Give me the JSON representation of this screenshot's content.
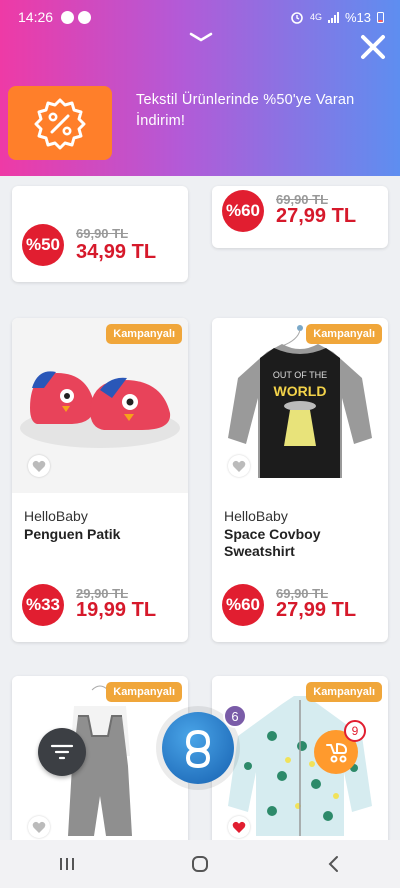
{
  "status_bar": {
    "time": "14:26",
    "network": "4G",
    "battery": "%13"
  },
  "banner": {
    "message": "Tekstil Ürünlerinde %50'ye Varan İndirim!",
    "icon": "percent-badge-icon"
  },
  "products": [
    {
      "discount": "%50",
      "old_price": "69,90 TL",
      "new_price": "34,99 TL"
    },
    {
      "discount": "%60",
      "old_price": "69,90 TL",
      "new_price": "27,99 TL"
    },
    {
      "badge": "Kampanyalı",
      "brand": "HelloBaby",
      "name": "Penguen Patik",
      "discount": "%33",
      "old_price": "29,90 TL",
      "new_price": "19,99 TL"
    },
    {
      "badge": "Kampanyalı",
      "brand": "HelloBaby",
      "name": "Space Covboy Sweatshirt",
      "discount": "%60",
      "old_price": "69,90 TL",
      "new_price": "27,99 TL"
    },
    {
      "badge": "Kampanyalı"
    },
    {
      "badge": "Kampanyalı"
    }
  ],
  "floating": {
    "main_count": "6",
    "cart_count": "9"
  },
  "colors": {
    "discount_red": "#e11e30",
    "price_red": "#d6192b",
    "badge_orange": "#f0a63a",
    "promo_orange": "#ff7f2a"
  }
}
